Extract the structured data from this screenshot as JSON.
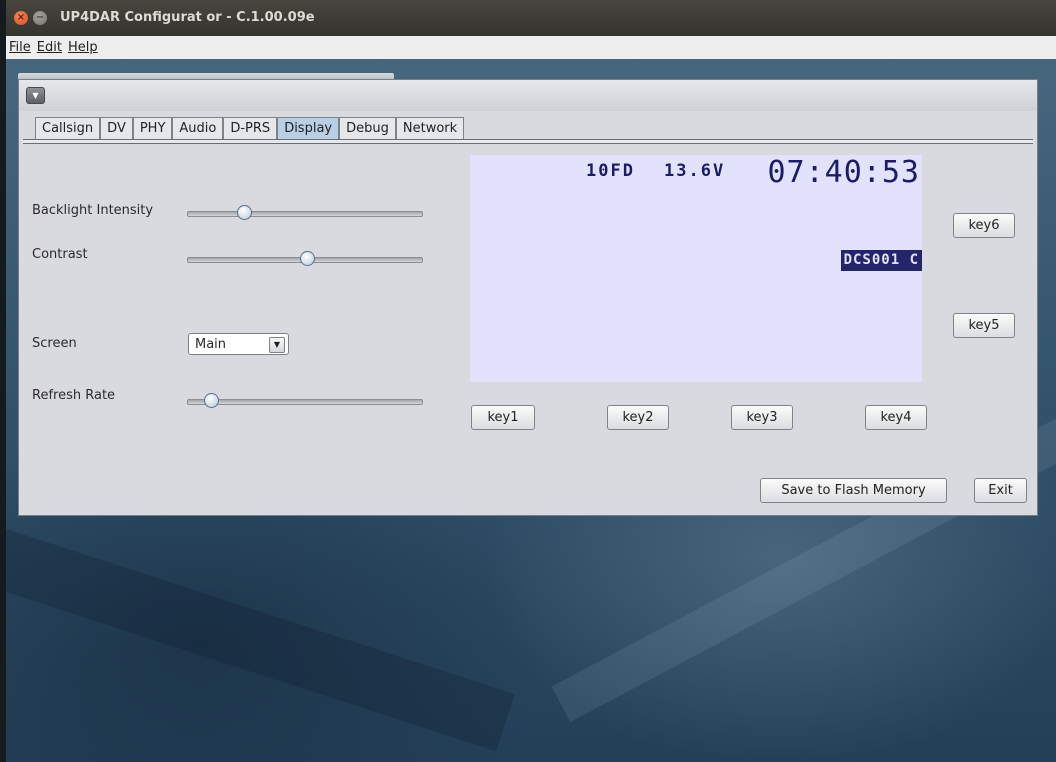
{
  "window": {
    "title": "UP4DAR Configurat or - C.1.00.09e",
    "close_glyph": "×",
    "min_glyph": "−"
  },
  "menu": [
    "File",
    "Edit",
    "Help"
  ],
  "tabs": [
    {
      "label": "Callsign",
      "active": false
    },
    {
      "label": "DV",
      "active": false
    },
    {
      "label": "PHY",
      "active": false
    },
    {
      "label": "Audio",
      "active": false
    },
    {
      "label": "D-PRS",
      "active": false
    },
    {
      "label": "Display",
      "active": true
    },
    {
      "label": "Debug",
      "active": false
    },
    {
      "label": "Network",
      "active": false
    }
  ],
  "display_panel": {
    "backlight_label": "Backlight Intensity",
    "backlight_value": 0.24,
    "contrast_label": "Contrast",
    "contrast_value": 0.51,
    "screen_label": "Screen",
    "screen_value": "Main",
    "refresh_label": "Refresh Rate",
    "refresh_value": 0.1
  },
  "lcd": {
    "status_a": "10FD",
    "status_b": "13.6V",
    "clock": "07:40:53",
    "reflector": "DCS001 C",
    "background": "#e2e2fc",
    "foreground": "#1b1b6a"
  },
  "keys": {
    "key1": "key1",
    "key2": "key2",
    "key3": "key3",
    "key4": "key4",
    "key5": "key5",
    "key6": "key6"
  },
  "actions": {
    "save": "Save to Flash Memory",
    "exit": "Exit"
  },
  "colors": {
    "active_tab": "#b8cfe5",
    "titlebar": "#3c3b37",
    "close_button": "#e9572a"
  }
}
